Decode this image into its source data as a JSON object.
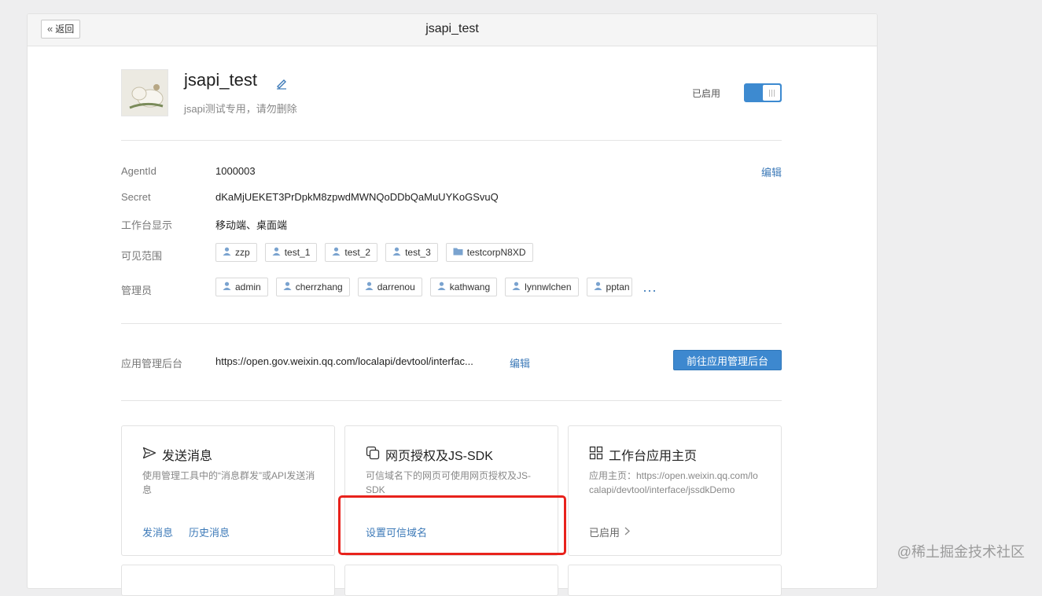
{
  "topbar": {
    "back_label": "返回",
    "title": "jsapi_test"
  },
  "app": {
    "name": "jsapi_test",
    "description": "jsapi测试专用，请勿删除",
    "status_label": "已启用",
    "enabled": true
  },
  "info": {
    "agentid_label": "AgentId",
    "agentid_value": "1000003",
    "edit_label": "编辑",
    "secret_label": "Secret",
    "secret_value": "dKaMjUEKET3PrDpkM8zpwdMWNQoDDbQaMuUYKoGSvuQ",
    "workbench_label": "工作台显示",
    "workbench_value": "移动端、桌面端",
    "visible_label": "可见范围",
    "visible_items": [
      {
        "label": "zzp",
        "icon": "user-icon"
      },
      {
        "label": "test_1",
        "icon": "user-icon"
      },
      {
        "label": "test_2",
        "icon": "user-icon"
      },
      {
        "label": "test_3",
        "icon": "user-icon"
      },
      {
        "label": "testcorpN8XD",
        "icon": "folder-icon"
      }
    ],
    "admin_label": "管理员",
    "admin_items": [
      "admin",
      "cherrzhang",
      "darrenou",
      "kathwang",
      "lynnwlchen",
      "pptan"
    ],
    "more_label": "..."
  },
  "backend": {
    "label": "应用管理后台",
    "url": "https://open.gov.weixin.qq.com/localapi/devtool/interfac...",
    "edit_label": "编辑",
    "goto_button": "前往应用管理后台"
  },
  "cards": [
    {
      "title": "发送消息",
      "icon": "send-icon",
      "desc": "使用管理工具中的“消息群发”或API发送消息",
      "actions": [
        "发消息",
        "历史消息"
      ]
    },
    {
      "title": "网页授权及JS-SDK",
      "icon": "copy-icon",
      "desc": "可信域名下的网页可使用网页授权及JS-SDK",
      "actions": [
        "设置可信域名"
      ]
    },
    {
      "title": "工作台应用主页",
      "icon": "grid-icon",
      "desc": "应用主页：https://open.weixin.qq.com/localapi/devtool/interface/jssdkDemo",
      "status": "已启用"
    }
  ],
  "watermark": "@稀土掘金技术社区",
  "colors": {
    "accent": "#3d88cf",
    "link": "#3d7ab8",
    "highlight": "#e8221c"
  }
}
